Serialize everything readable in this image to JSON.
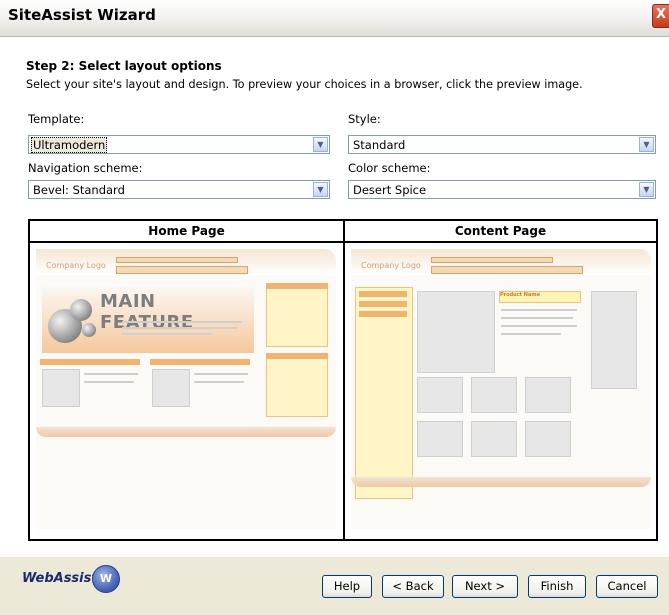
{
  "window": {
    "title": "SiteAssist Wizard",
    "close_glyph": "X"
  },
  "step": {
    "title": "Step 2: Select layout options",
    "description": "Select your site's layout and design. To preview your choices in a browser, click the preview image."
  },
  "fields": {
    "template": {
      "label": "Template:",
      "value": "Ultramodern"
    },
    "style": {
      "label": "Style:",
      "value": "Standard"
    },
    "navigation": {
      "label": "Navigation scheme:",
      "value": "Bevel: Standard"
    },
    "color": {
      "label": "Color scheme:",
      "value": "Desert Spice"
    }
  },
  "preview": {
    "home_title": "Home Page",
    "content_title": "Content Page",
    "home_logo": "Company Logo",
    "home_feature": "MAIN FEATURE",
    "content_logo": "Company Logo",
    "product_name": "Product Name"
  },
  "footer": {
    "brand": "WebAssist",
    "buttons": {
      "help": "Help",
      "back": "< Back",
      "next": "Next >",
      "finish": "Finish",
      "cancel": "Cancel"
    }
  },
  "colors": {
    "accent_orange": "#f1b370",
    "title_blue": "#003c74"
  }
}
